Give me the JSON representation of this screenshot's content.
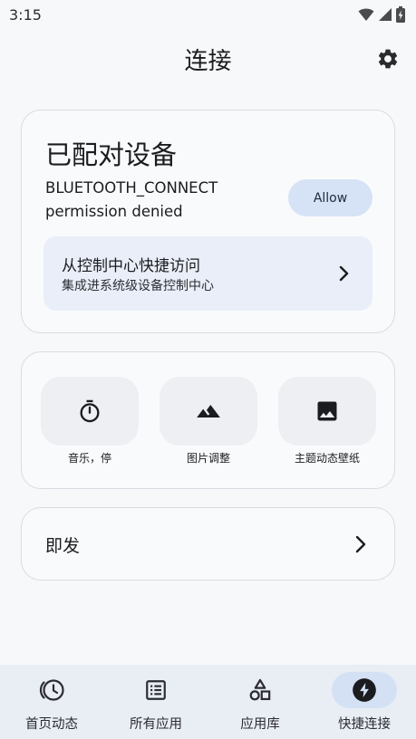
{
  "status_bar": {
    "time": "3:15"
  },
  "app_bar": {
    "title": "连接",
    "settings_icon": "gear-icon"
  },
  "paired_devices": {
    "title": "已配对设备",
    "permission_line1": "BLUETOOTH_CONNECT",
    "permission_line2": "permission denied",
    "allow_label": "Allow",
    "control_center": {
      "title": "从控制中心快捷访问",
      "subtitle": "集成进系统级设备控制中心"
    }
  },
  "tiles": [
    {
      "label": "音乐，停",
      "icon": "timer-icon"
    },
    {
      "label": "图片调整",
      "icon": "landscape-icon"
    },
    {
      "label": "主题动态壁纸",
      "icon": "image-icon"
    }
  ],
  "instant": {
    "label": "即发"
  },
  "bottom_nav": [
    {
      "label": "首页动态",
      "icon": "history-icon",
      "active": false
    },
    {
      "label": "所有应用",
      "icon": "list-icon",
      "active": false
    },
    {
      "label": "应用库",
      "icon": "shapes-icon",
      "active": false
    },
    {
      "label": "快捷连接",
      "icon": "bolt-icon",
      "active": true
    }
  ],
  "colors": {
    "background": "#f7f8fa",
    "allow_button": "#d6e2f5",
    "control_center_panel": "#e9eef8",
    "tile": "#eeeff2",
    "bottom_nav": "#e9edf4",
    "active_indicator": "#d4e1f5"
  }
}
